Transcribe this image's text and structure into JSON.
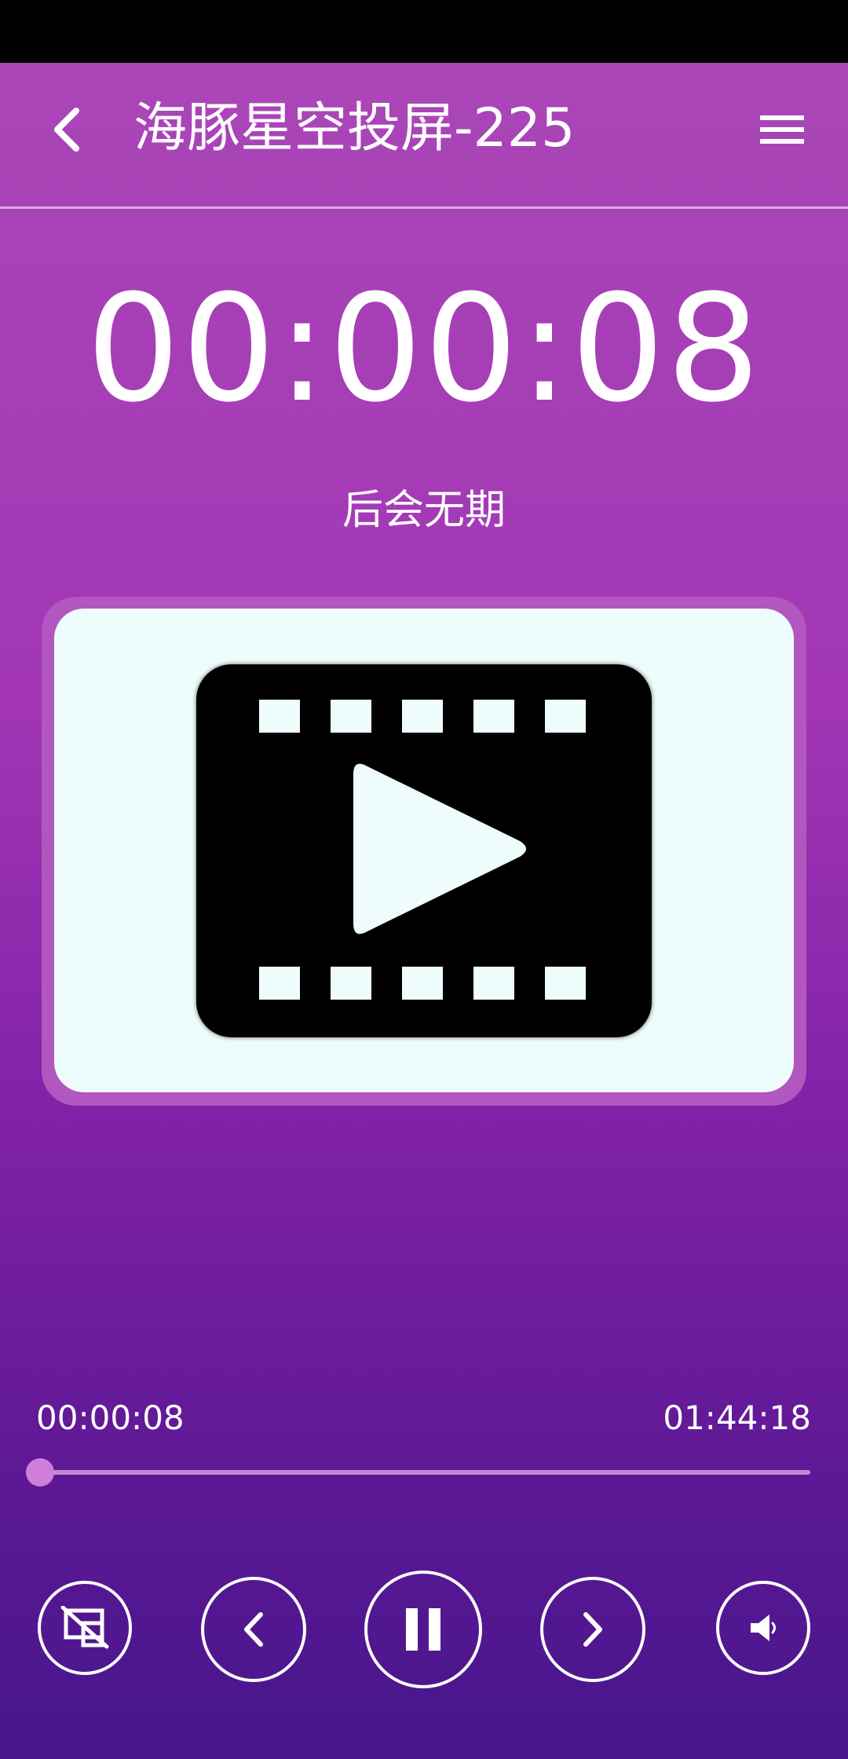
{
  "header": {
    "title": "海豚星空投屏-225"
  },
  "player": {
    "clock": "00:00:08",
    "song_title": "后会无期",
    "current_time": "00:00:08",
    "total_time": "01:44:18",
    "progress": 0.0013
  },
  "icons": {
    "back": "back-arrow-icon",
    "menu": "menu-icon",
    "cover": "video-film-icon",
    "stop_cast": "cast-off-icon",
    "previous": "chevron-left-icon",
    "pause": "pause-icon",
    "next": "chevron-right-icon",
    "volume": "volume-icon"
  },
  "colors": {
    "accent": "#cd7fd9",
    "card": "#eefcfb",
    "frame": "#b256c0"
  }
}
